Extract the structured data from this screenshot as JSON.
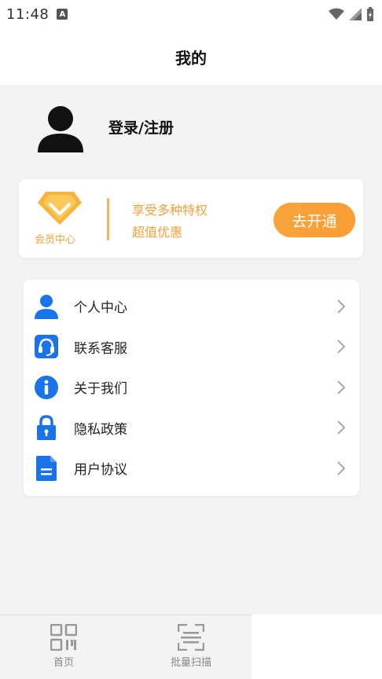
{
  "status_bar": {
    "time": "11:48",
    "notification_icon": "A"
  },
  "header": {
    "title": "我的"
  },
  "profile": {
    "login_label": "登录/注册"
  },
  "vip": {
    "label": "会员中心",
    "line1": "享受多种特权",
    "line2": "超值优惠",
    "button_label": "去开通",
    "accent_color": "#f0a23a"
  },
  "menu": {
    "items": [
      {
        "label": "个人中心",
        "icon": "person-icon"
      },
      {
        "label": "联系客服",
        "icon": "headset-icon"
      },
      {
        "label": "关于我们",
        "icon": "info-icon"
      },
      {
        "label": "隐私政策",
        "icon": "lock-icon"
      },
      {
        "label": "用户协议",
        "icon": "document-icon"
      }
    ],
    "icon_color": "#1a73e8"
  },
  "bottom_nav": {
    "items": [
      {
        "label": "首页",
        "icon": "qr-code-icon"
      },
      {
        "label": "批量扫描",
        "icon": "scan-icon"
      }
    ]
  }
}
